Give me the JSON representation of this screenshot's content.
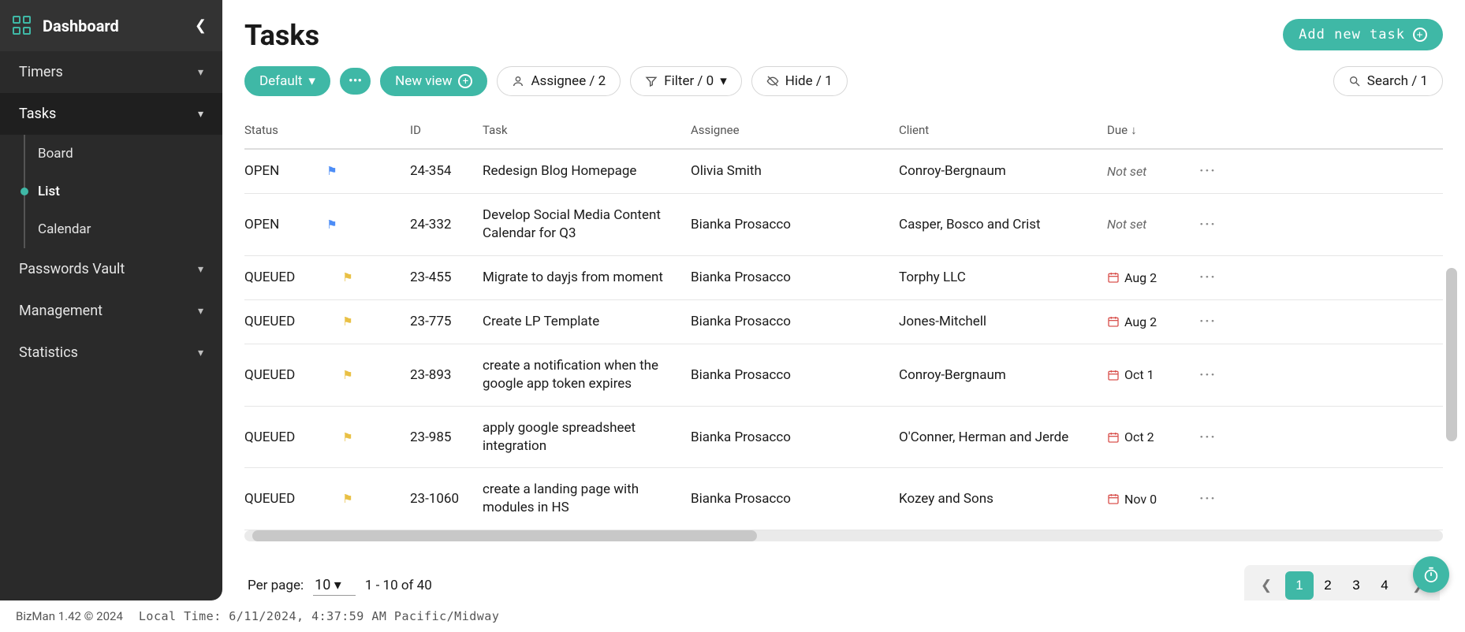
{
  "sidebar": {
    "title": "Dashboard",
    "groups": [
      {
        "label": "Timers"
      },
      {
        "label": "Tasks",
        "children": [
          "Board",
          "List",
          "Calendar"
        ],
        "active_child": 1
      },
      {
        "label": "Passwords Vault"
      },
      {
        "label": "Management"
      },
      {
        "label": "Statistics"
      }
    ]
  },
  "page": {
    "title": "Tasks"
  },
  "toolbar": {
    "default_view": "Default",
    "new_view": "New view",
    "assignee": "Assignee / 2",
    "filter": "Filter / 0",
    "hide": "Hide / 1",
    "search": "Search / 1",
    "add": "Add new task"
  },
  "columns": {
    "status": "Status",
    "id": "ID",
    "task": "Task",
    "assignee": "Assignee",
    "client": "Client",
    "due": "Due"
  },
  "rows": [
    {
      "status": "OPEN",
      "flag": "blue",
      "id": "24-354",
      "task": "Redesign Blog Homepage",
      "assignee": "Olivia Smith",
      "client": "Conroy-Bergnaum",
      "due_label": "Not set",
      "has_date": false
    },
    {
      "status": "OPEN",
      "flag": "blue",
      "id": "24-332",
      "task": "Develop Social Media Content Calendar for Q3",
      "assignee": "Bianka Prosacco",
      "client": "Casper, Bosco and Crist",
      "due_label": "Not set",
      "has_date": false
    },
    {
      "status": "QUEUED",
      "flag": "yellow",
      "id": "23-455",
      "task": "Migrate to dayjs from moment",
      "assignee": "Bianka Prosacco",
      "client": "Torphy LLC",
      "due_label": "Aug 2",
      "has_date": true
    },
    {
      "status": "QUEUED",
      "flag": "yellow",
      "id": "23-775",
      "task": "Create LP Template",
      "assignee": "Bianka Prosacco",
      "client": "Jones-Mitchell",
      "due_label": "Aug 2",
      "has_date": true
    },
    {
      "status": "QUEUED",
      "flag": "yellow",
      "id": "23-893",
      "task": "create a notification when the google app token expires",
      "assignee": "Bianka Prosacco",
      "client": "Conroy-Bergnaum",
      "due_label": "Oct 1",
      "has_date": true
    },
    {
      "status": "QUEUED",
      "flag": "yellow",
      "id": "23-985",
      "task": "apply google spreadsheet integration",
      "assignee": "Bianka Prosacco",
      "client": "O'Conner, Herman and Jerde",
      "due_label": "Oct 2",
      "has_date": true
    },
    {
      "status": "QUEUED",
      "flag": "yellow",
      "id": "23-1060",
      "task": "create a landing page with modules in HS",
      "assignee": "Bianka Prosacco",
      "client": "Kozey and Sons",
      "due_label": "Nov 0",
      "has_date": true
    }
  ],
  "paging": {
    "per_page_label": "Per page:",
    "per_page_value": "10",
    "range": "1 - 10 of 40",
    "pages": [
      "1",
      "2",
      "3",
      "4"
    ],
    "active_page": 0
  },
  "footer": {
    "copyright": "BizMan 1.42 © 2024",
    "local_time": "Local Time: 6/11/2024, 4:37:59 AM Pacific/Midway"
  }
}
